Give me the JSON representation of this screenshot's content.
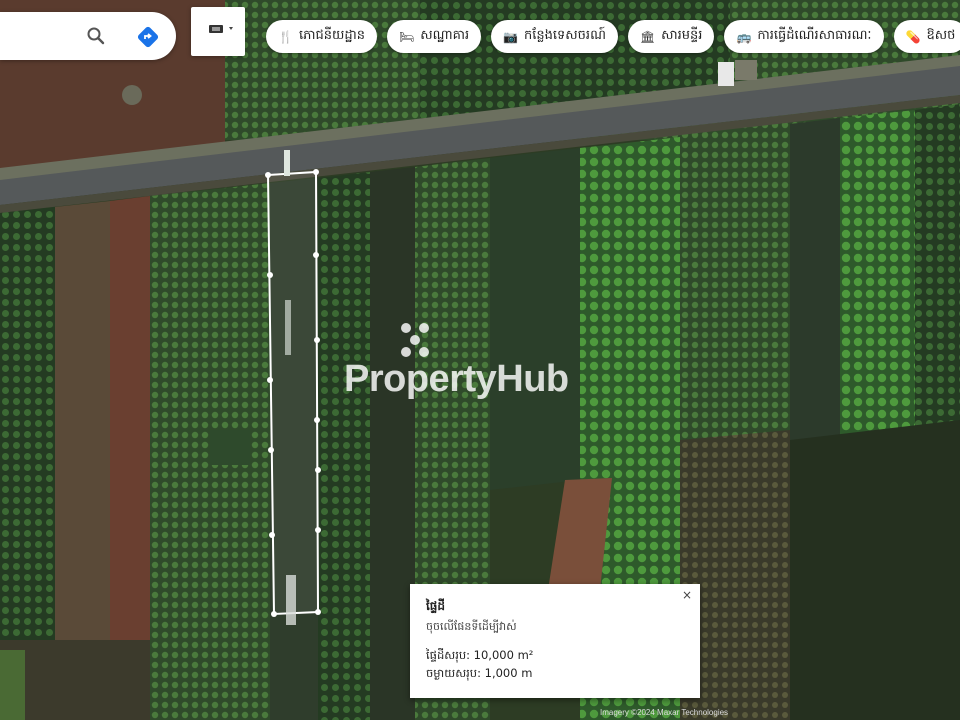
{
  "search": {
    "value": "",
    "placeholder": ""
  },
  "search_icon": "search-icon",
  "directions_icon": "directions-icon",
  "layers_icon": "layers-icon",
  "category_chips": [
    {
      "icon": "restaurant-icon",
      "label": "ភោជនីយដ្ឋាន"
    },
    {
      "icon": "hotel-icon",
      "label": "សណ្ឋាគារ"
    },
    {
      "icon": "attraction-icon",
      "label": "កន្លែងទេសចរណ៍"
    },
    {
      "icon": "museum-icon",
      "label": "សារមន្ទីរ"
    },
    {
      "icon": "transit-icon",
      "label": "ការធ្វើដំណើរសាធារណៈ"
    },
    {
      "icon": "pharmacy-icon",
      "label": "ឱសថ"
    }
  ],
  "info_popup": {
    "title": "ផ្ទៃដី",
    "subtitle": "ចុចលើផែនទីដើម្បីវាស់",
    "line1": "ផ្ទៃដីសរុប: 10,000 m²",
    "line2": "ចម្ងាយសរុប: 1,000 m"
  },
  "watermark": "PropertyHub",
  "footer_attribution": "Imagery ©2024 Maxar Technologies",
  "colors": {
    "accent": "#1a73e8",
    "measure_line": "#ffffff"
  }
}
